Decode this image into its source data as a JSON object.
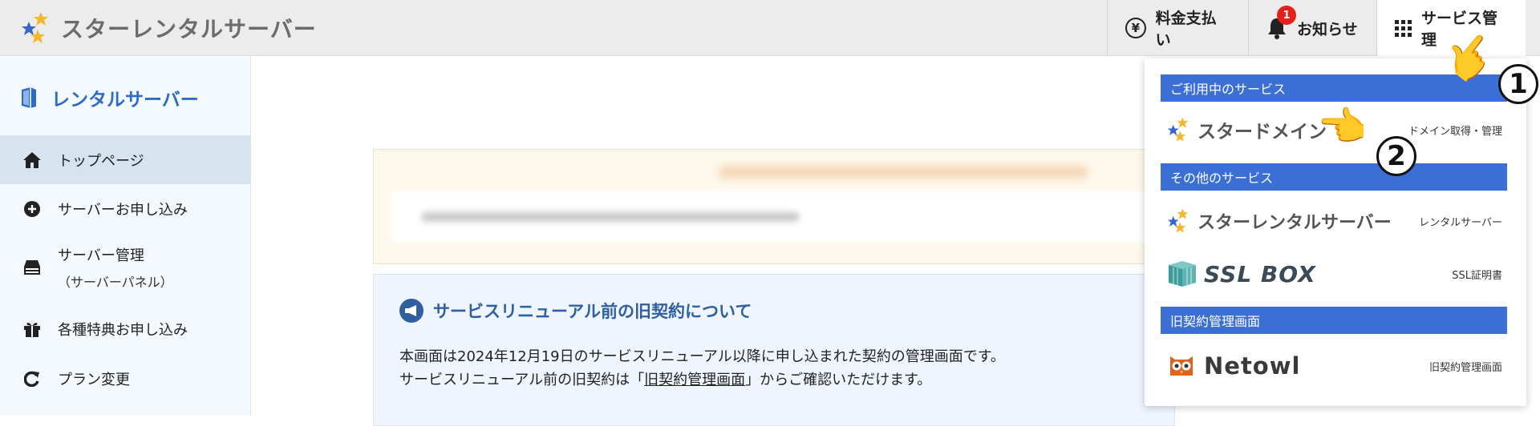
{
  "header": {
    "logo_text": "スターレンタルサーバー",
    "buttons": {
      "payment": "料金支払い",
      "news": "お知らせ",
      "news_badge": "1",
      "service": "サービス管理"
    }
  },
  "sidebar": {
    "title": "レンタルサーバー",
    "items": [
      {
        "label": "トップページ"
      },
      {
        "label": "サーバーお申し込み"
      },
      {
        "label": "サーバー管理",
        "sub": "（サーバーパネル）"
      },
      {
        "label": "各種特典お申し込み"
      },
      {
        "label": "プラン変更"
      }
    ]
  },
  "notice": {
    "title": "サービスリニューアル前の旧契約について",
    "line1": "本画面は2024年12月19日のサービスリニューアル以降に申し込まれた契約の管理画面です。",
    "line2_pre": "サービスリニューアル前の旧契約は「",
    "line2_link": "旧契約管理画面",
    "line2_post": "」からご確認いただけます。"
  },
  "dropdown": {
    "sections": [
      {
        "title": "ご利用中のサービス"
      },
      {
        "title": "その他のサービス"
      },
      {
        "title": "旧契約管理画面"
      }
    ],
    "rows": [
      {
        "brand": "スタードメイン",
        "desc": "ドメイン取得・管理"
      },
      {
        "brand": "スターレンタルサーバー",
        "desc": "レンタルサーバー"
      },
      {
        "brand": "SSL BOX",
        "desc": "SSL証明書"
      },
      {
        "brand": "Netowl",
        "desc": "旧契約管理画面"
      }
    ]
  },
  "annotations": {
    "step1": "1",
    "step2": "2"
  },
  "colors": {
    "accent": "#3c6fd6",
    "sidebar_title": "#2e6bc8",
    "notice_title": "#2f5f9f",
    "badge": "#e8201a"
  }
}
